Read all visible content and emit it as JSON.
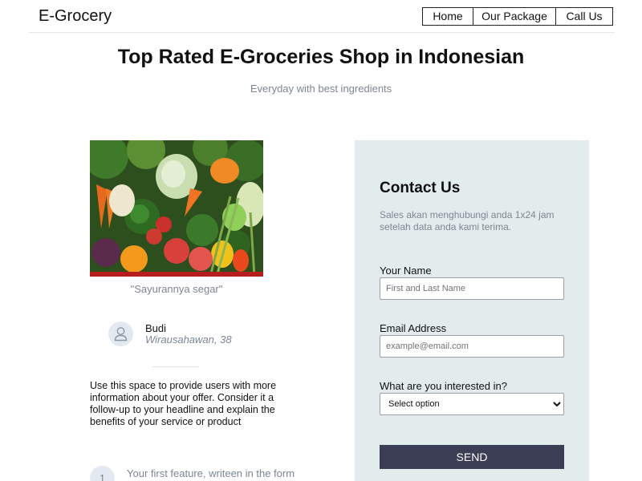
{
  "nav": {
    "brand": "E-Grocery",
    "links": [
      "Home",
      "Our Package",
      "Call Us"
    ]
  },
  "hero": {
    "title": "Top Rated E-Groceries Shop in Indonesian",
    "subtitle": "Everyday with best ingredients"
  },
  "showcase": {
    "image": "vegetables-photo",
    "caption": "\"Sayurannya segar\""
  },
  "testimonial": {
    "avatar_icon": "user-icon",
    "name": "Budi",
    "role": "Wirausahawan, 38"
  },
  "info_text": "Use this space to provide users with more information about your offer. Consider it a follow-up to your headline and explain the benefits of your service or product",
  "feature": {
    "number": "1",
    "text": "Your first feature, writeen in the form"
  },
  "contact": {
    "title": "Contact Us",
    "text": "Sales akan menghubungi anda 1x24 jam setelah data anda kami terima.",
    "name_label": "Your Name",
    "name_placeholder": "First and Last Name",
    "email_label": "Email Address",
    "email_placeholder": "example@email.com",
    "interest_label": "What are you interested in?",
    "interest_selected": "Select option",
    "send_label": "SEND"
  },
  "colors": {
    "panel_bg": "#e3ecec",
    "button_bg": "#3c3e55",
    "muted_text": "#7d8693"
  }
}
